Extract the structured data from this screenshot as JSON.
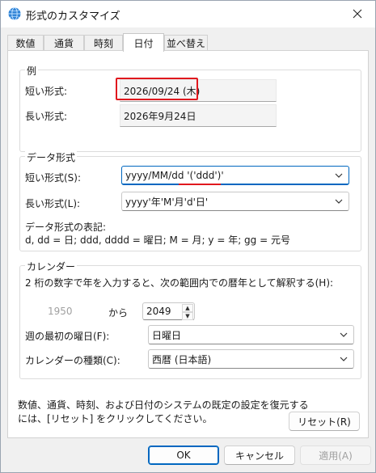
{
  "window": {
    "title": "形式のカスタマイズ"
  },
  "tabs": [
    {
      "label": "数値"
    },
    {
      "label": "通貨"
    },
    {
      "label": "時刻"
    },
    {
      "label": "日付"
    },
    {
      "label": "並べ替え"
    }
  ],
  "sample": {
    "title": "例",
    "short_label": "短い形式:",
    "short_value": "2026/09/24 (木)",
    "long_label": "長い形式:",
    "long_value": "2026年9月24日"
  },
  "date_format": {
    "title": "データ形式",
    "short_label": "短い形式(S):",
    "short_value": "yyyy/MM/dd '('ddd')'",
    "long_label": "長い形式(L):",
    "long_value": "yyyy'年'M'月'd'日'",
    "notation_label": "データ形式の表記:",
    "notation_text": "d, dd = 日;  ddd, dddd = 曜日; M = 月; y = 年; gg = 元号"
  },
  "calendar": {
    "title": "カレンダー",
    "interpret_text": "2 桁の数字で年を入力すると、次の範囲内での暦年として解釈する(H):",
    "from_year": "1950",
    "kara": "から",
    "to_year": "2049",
    "first_day_label": "週の最初の曜日(F):",
    "first_day_value": "日曜日",
    "type_label": "カレンダーの種類(C):",
    "type_value": "西暦 (日本語)"
  },
  "footer": {
    "line1": "数値、通貨、時刻、および日付のシステムの既定の設定を復元する",
    "line2": "には、[リセット] をクリックしてください。",
    "reset_label": "リセット(R)"
  },
  "buttons": {
    "ok": "OK",
    "cancel": "キャンセル",
    "apply": "適用(A)"
  },
  "colors": {
    "accent": "#0067c0",
    "highlight": "#e0181e"
  }
}
